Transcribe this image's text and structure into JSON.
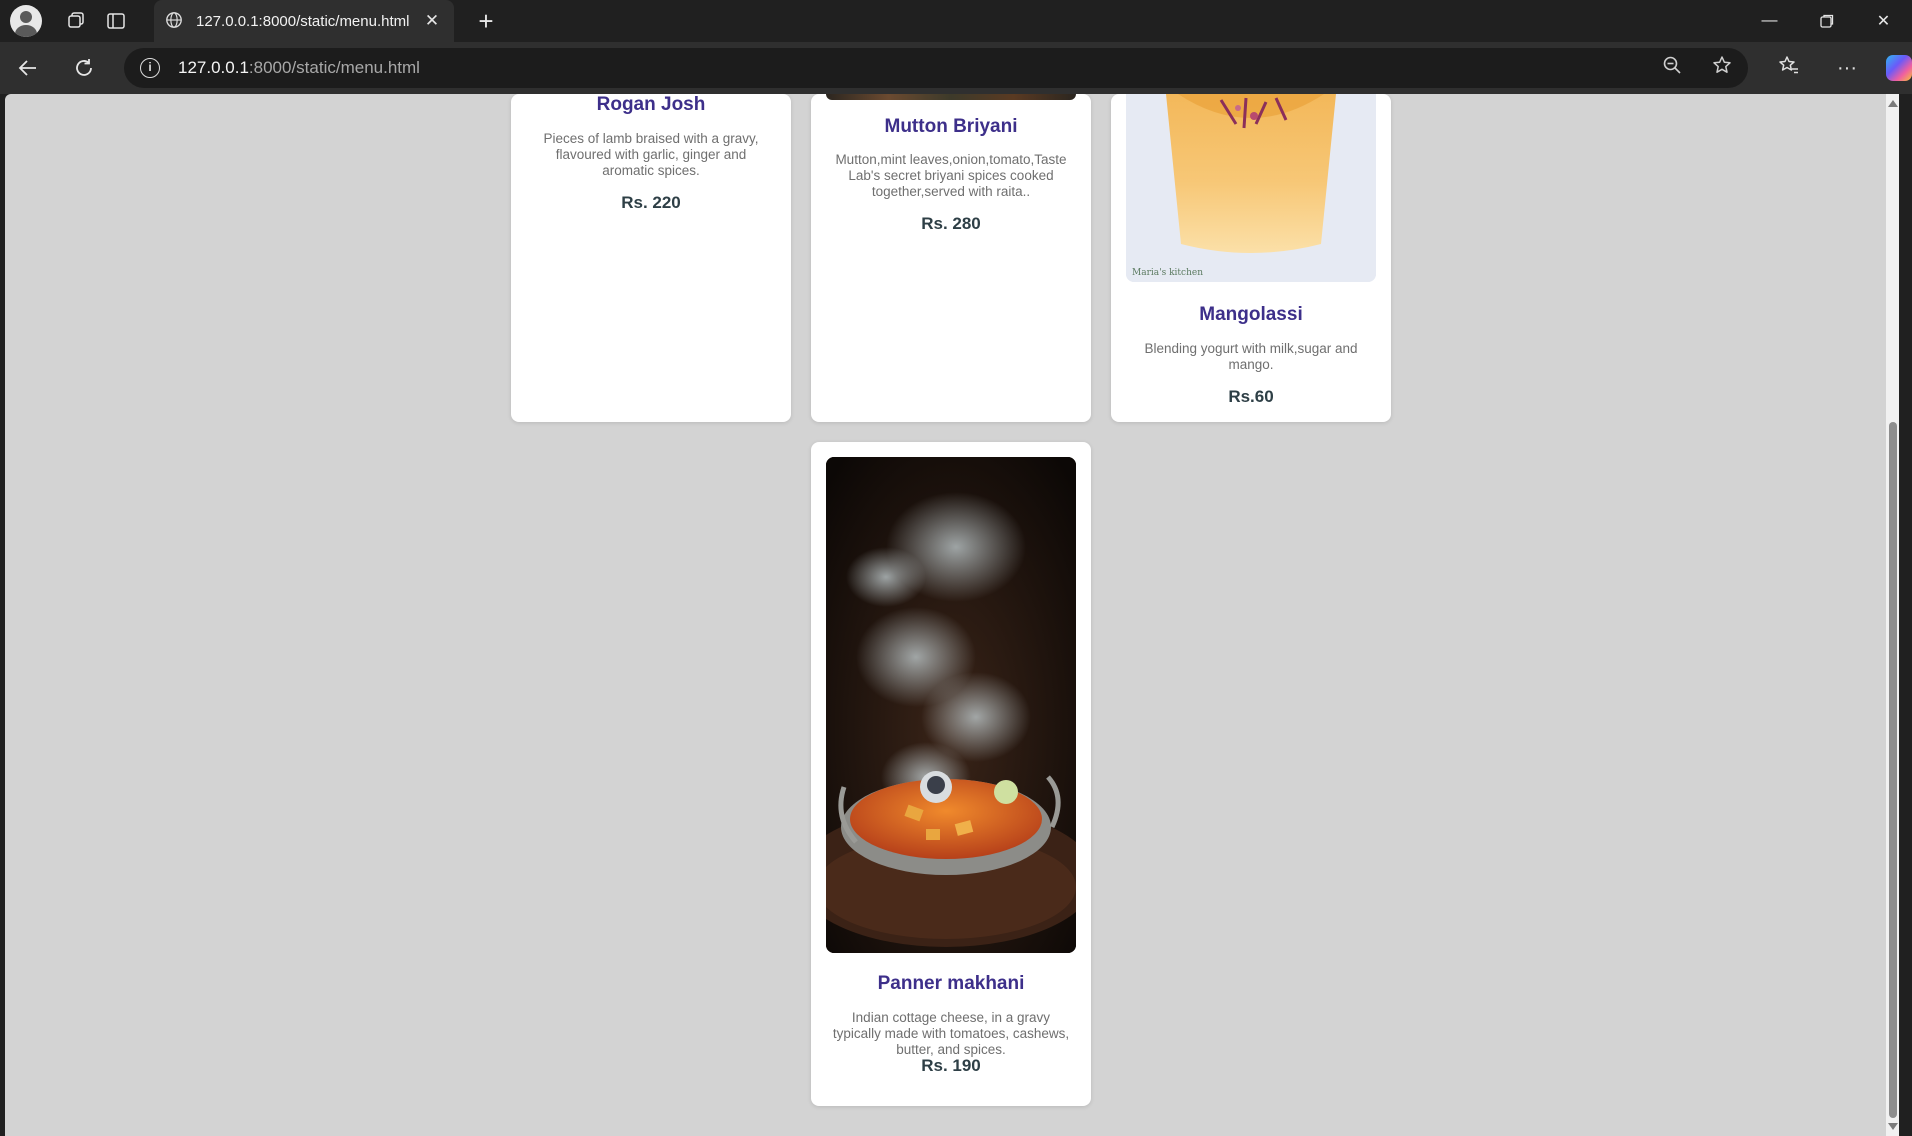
{
  "browser": {
    "tab_title": "127.0.0.1:8000/static/menu.html",
    "url_host": "127.0.0.1",
    "url_rest": ":8000/static/menu.html"
  },
  "menu": {
    "items": [
      {
        "name": "Rogan Josh",
        "description": "Pieces of lamb braised with a gravy, flavoured with garlic, ginger and aromatic spices.",
        "price": "Rs. 220"
      },
      {
        "name": "Mutton Briyani",
        "description": "Mutton,mint leaves,onion,tomato,Taste Lab's secret briyani spices cooked together,served with raita..",
        "price": "Rs. 280"
      },
      {
        "name": "Mangolassi",
        "description": "Blending yogurt with milk,sugar and mango.",
        "price": "Rs.60",
        "image_watermark": "Maria's kitchen"
      },
      {
        "name": "Panner makhani",
        "description": "Indian cottage cheese, in a gravy typically made with tomatoes, cashews, butter, and spices.",
        "price": "Rs. 190"
      }
    ]
  },
  "colors": {
    "page_background": "#d3d3d3",
    "item_name": "#3d2f8a",
    "item_price": "#2e3f46",
    "item_description": "#6f6f6f"
  },
  "icons": {
    "profile": "profile-avatar-icon",
    "workspaces": "workspaces-icon",
    "tab_actions": "tab-actions-icon",
    "globe": "globe-icon",
    "close": "close-icon",
    "new_tab": "plus-icon",
    "minimize": "minimize-icon",
    "restore": "restore-icon",
    "window_close": "close-icon",
    "back": "back-arrow-icon",
    "refresh": "refresh-icon",
    "site_info": "info-icon",
    "zoom": "zoom-out-icon",
    "favorite": "star-icon",
    "favorites": "favorites-icon",
    "more": "more-icon",
    "copilot": "copilot-icon"
  }
}
